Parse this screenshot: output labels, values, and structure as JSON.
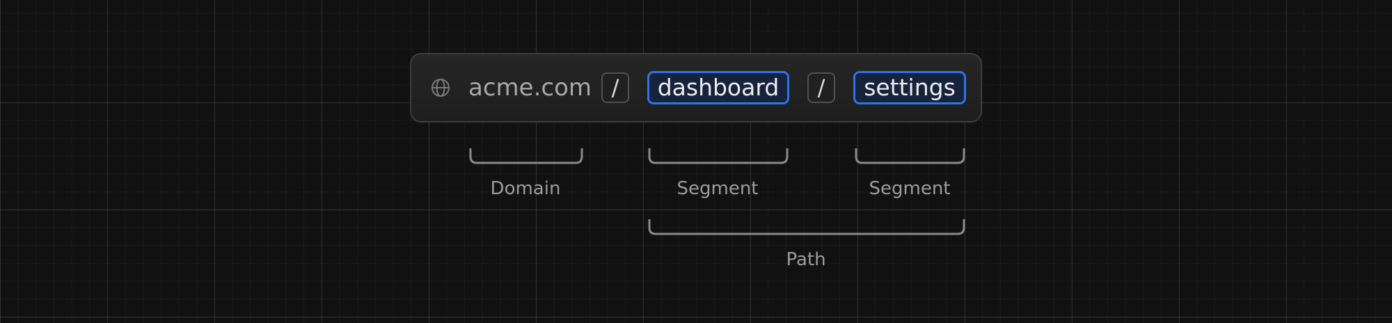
{
  "url_bar": {
    "icon": "globe-icon",
    "domain": "acme.com",
    "separator_1": "/",
    "segment_1": "dashboard",
    "separator_2": "/",
    "segment_2": "settings"
  },
  "annotations": {
    "domain": "Domain",
    "segment_1": "Segment",
    "segment_2": "Segment",
    "path": "Path"
  },
  "colors": {
    "background": "#111111",
    "grid_line": "#2a2a2a",
    "segment_highlight": "#2f74e6",
    "bracket": "#8a8a8a",
    "label_text": "#9c9c9c"
  }
}
